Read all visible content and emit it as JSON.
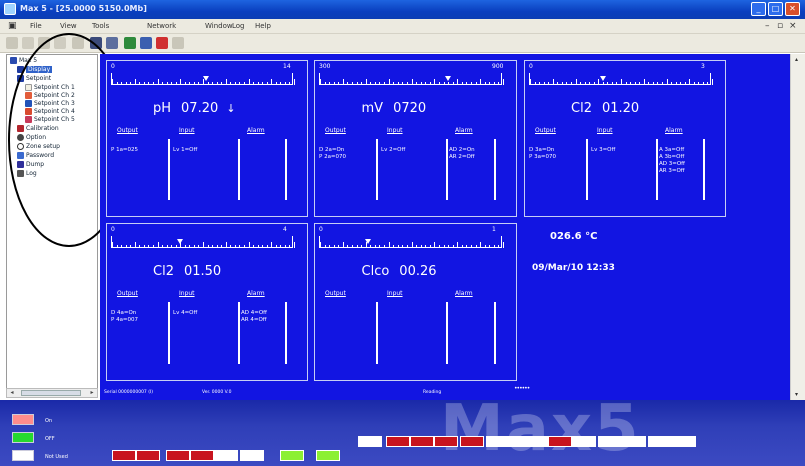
{
  "window": {
    "title": "Max 5 - [25.0000 5150.0Mb]"
  },
  "menubar": {
    "items": [
      "File",
      "View",
      "Tools",
      "Network",
      "Window",
      "Log",
      "Help"
    ]
  },
  "tree": {
    "root": "Max 5",
    "items": [
      "Display",
      "Setpoint",
      "Setpoint Ch 1",
      "Setpoint Ch 2",
      "Setpoint Ch 3",
      "Setpoint Ch 4",
      "Setpoint Ch 5",
      "Calibration",
      "Option",
      "Zone setup",
      "Password",
      "Dump",
      "Log"
    ]
  },
  "panels": [
    {
      "min": "0",
      "max": "14",
      "param": "pH",
      "value": "07.20",
      "trend": "↓",
      "output_label": "Output",
      "input_label": "Input",
      "alarm_label": "Alarm",
      "output": [
        "P 1a=025"
      ],
      "input": [
        "Lv 1=Off"
      ],
      "alarm": []
    },
    {
      "min": "300",
      "max": "900",
      "param": "mV",
      "value": "0720",
      "trend": "",
      "output_label": "Output",
      "input_label": "Input",
      "alarm_label": "Alarm",
      "output": [
        "D 2a=On",
        "P 2a=070"
      ],
      "input": [
        "Lv 2=Off"
      ],
      "alarm": [
        "AD 2=On",
        "AR 2=Off"
      ]
    },
    {
      "min": "0",
      "max": "3",
      "param": "Cl2",
      "value": "01.20",
      "trend": "",
      "output_label": "Output",
      "input_label": "Input",
      "alarm_label": "Alarm",
      "output": [
        "D 3a=On",
        "P 3a=070"
      ],
      "input": [
        "Lv 3=Off"
      ],
      "alarm": [
        "A 3a=Off",
        "A 3b=Off",
        "AD 3=Off",
        "AR 3=Off"
      ]
    },
    {
      "min": "0",
      "max": "4",
      "param": "Cl2",
      "value": "01.50",
      "trend": "",
      "output_label": "Output",
      "input_label": "Input",
      "alarm_label": "Alarm",
      "output": [
        "D 4a=On",
        "P 4a=007"
      ],
      "input": [
        "Lv 4=Off"
      ],
      "alarm": [
        "AD 4=Off",
        "AR 4=Off"
      ]
    },
    {
      "min": "0",
      "max": "1",
      "param": "Clco",
      "value": "00.26",
      "trend": "",
      "output_label": "Output",
      "input_label": "Input",
      "alarm_label": "Alarm",
      "output": [],
      "input": [],
      "alarm": []
    }
  ],
  "temperature": "026.6 °C",
  "datetime": "09/Mar/10  12:33",
  "status": {
    "serial": "Serial 0000000007 (I)",
    "version": "Ver. 0000 V.0",
    "state": "Reading",
    "dots": "••••••"
  },
  "legend": [
    {
      "label": "On",
      "color": "#ff8c8c"
    },
    {
      "label": "OFF",
      "color": "#26d92e"
    },
    {
      "label": "Not Used",
      "color": "#ffffff"
    }
  ],
  "logo": "Max5",
  "colors": {
    "panel_bg": "#1215e2",
    "red_indicator": "#c8141e",
    "green_indicator": "#8cf032"
  }
}
